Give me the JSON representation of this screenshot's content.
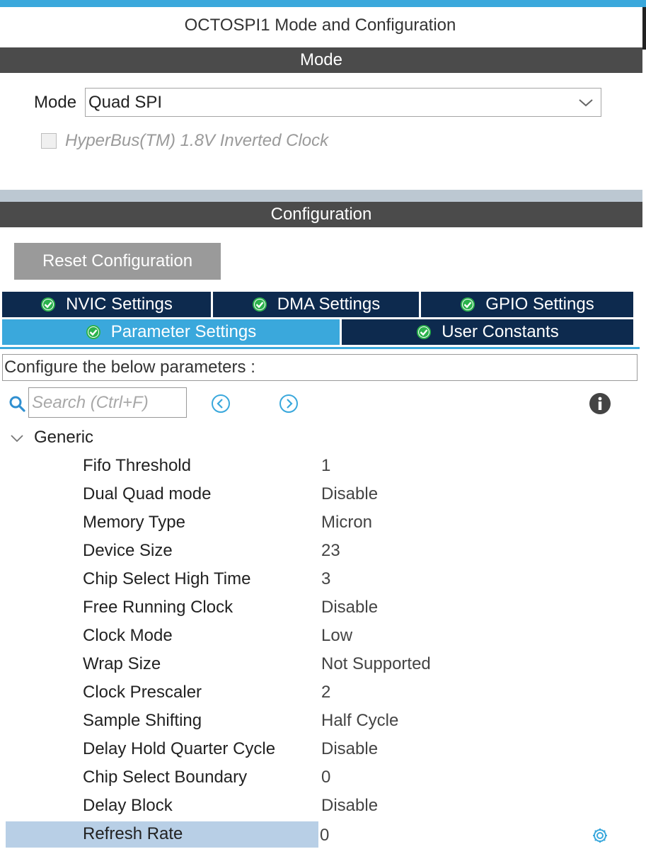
{
  "window": {
    "title": "OCTOSPI1 Mode and Configuration"
  },
  "mode_section": {
    "header": "Mode",
    "mode_label": "Mode",
    "mode_value": "Quad SPI",
    "hyperbus_label": "HyperBus(TM) 1.8V Inverted Clock",
    "hyperbus_checked": false
  },
  "config_section": {
    "header": "Configuration",
    "reset_button": "Reset Configuration"
  },
  "tabs": {
    "row1": [
      "NVIC Settings",
      "DMA Settings",
      "GPIO Settings"
    ],
    "row2": [
      "Parameter Settings",
      "User Constants"
    ],
    "active": "Parameter Settings"
  },
  "parameters": {
    "instruction": "Configure the below parameters :",
    "search_placeholder": "Search (Ctrl+F)",
    "group": "Generic",
    "rows": [
      {
        "name": "Fifo Threshold",
        "value": "1"
      },
      {
        "name": "Dual Quad mode",
        "value": "Disable"
      },
      {
        "name": "Memory Type",
        "value": "Micron"
      },
      {
        "name": "Device Size",
        "value": "23"
      },
      {
        "name": "Chip Select High Time",
        "value": "3"
      },
      {
        "name": "Free Running Clock",
        "value": "Disable"
      },
      {
        "name": "Clock Mode",
        "value": "Low"
      },
      {
        "name": "Wrap Size",
        "value": "Not Supported"
      },
      {
        "name": "Clock Prescaler",
        "value": "2"
      },
      {
        "name": "Sample Shifting",
        "value": "Half Cycle"
      },
      {
        "name": "Delay Hold Quarter Cycle",
        "value": "Disable"
      },
      {
        "name": "Chip Select Boundary",
        "value": "0"
      },
      {
        "name": "Delay Block",
        "value": "Disable"
      },
      {
        "name": "Refresh Rate",
        "value": "0"
      }
    ],
    "selected_row": "Refresh Rate"
  },
  "colors": {
    "accent": "#3aa8dc",
    "tab_dark": "#0d2a4e",
    "header_bar": "#4b4b4b",
    "check_green": "#2bb24c",
    "selection": "#b8cfe6"
  },
  "icons": {
    "check": "check-circle-icon",
    "search": "search-icon",
    "prev": "chevron-left-circle-icon",
    "next": "chevron-right-circle-icon",
    "info": "info-icon",
    "gear": "gear-icon"
  }
}
